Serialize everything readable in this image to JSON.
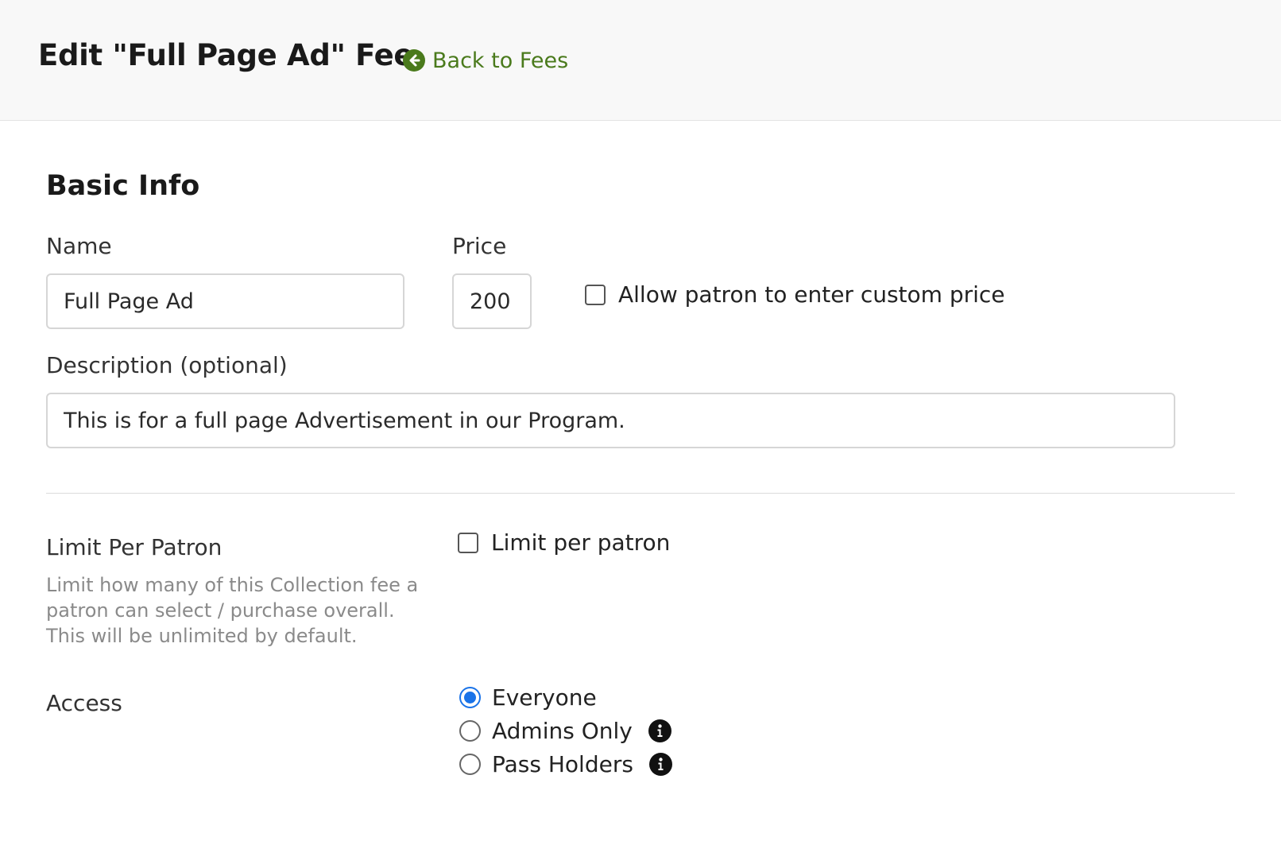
{
  "header": {
    "title": "Edit \"Full Page Ad\" Fee",
    "back_label": "Back to Fees",
    "back_icon": "arrow-circle-left-icon",
    "accent_color": "#4a7a1c"
  },
  "basic_info": {
    "section_title": "Basic Info",
    "name_label": "Name",
    "name_value": "Full Page Ad",
    "price_label": "Price",
    "price_value": "200",
    "custom_price_label": "Allow patron to enter custom price",
    "custom_price_checked": false,
    "description_label": "Description (optional)",
    "description_value": "This is for a full page Advertisement in our Program."
  },
  "limit": {
    "title": "Limit Per Patron",
    "help": "Limit how many of this Collection fee a patron can select / purchase overall. This will be unlimited by default.",
    "checkbox_label": "Limit per patron",
    "checked": false
  },
  "access": {
    "title": "Access",
    "options": [
      {
        "label": "Everyone",
        "checked": true,
        "info": false
      },
      {
        "label": "Admins Only",
        "checked": false,
        "info": true,
        "info_icon": "info-circle-icon"
      },
      {
        "label": "Pass Holders",
        "checked": false,
        "info": true,
        "info_icon": "info-circle-icon"
      }
    ],
    "selected_color": "#1a73e8"
  }
}
